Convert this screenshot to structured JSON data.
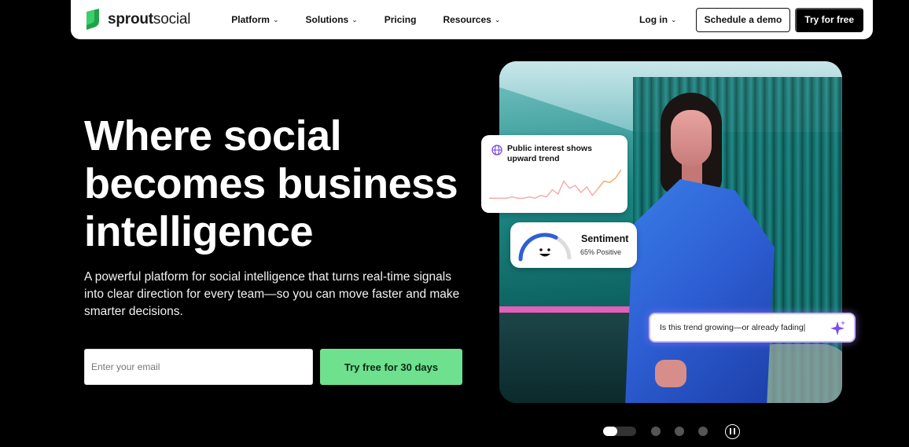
{
  "nav": {
    "logo_bold": "sprout",
    "logo_light": "social",
    "links": [
      {
        "label": "Platform",
        "has_menu": true
      },
      {
        "label": "Solutions",
        "has_menu": true
      },
      {
        "label": "Pricing",
        "has_menu": false
      },
      {
        "label": "Resources",
        "has_menu": true
      }
    ],
    "login_label": "Log in",
    "demo_label": "Schedule a demo",
    "try_label": "Try for free",
    "chevron": "⌄"
  },
  "hero": {
    "headline_lines": [
      "Where social",
      "becomes business",
      "intelligence"
    ],
    "sub_lines": [
      "A powerful platform for social intelligence that turns real-time signals",
      "into clear direction for every team—so you can move faster and make",
      "smarter decisions."
    ],
    "email_placeholder": "Enter your email",
    "cta_label": "Try free for 30 days"
  },
  "cards": {
    "trend_title": "Public interest shows upward trend",
    "trend_series": [
      2,
      2,
      2,
      2,
      3,
      2,
      2,
      3,
      2,
      4,
      3,
      8,
      5,
      14,
      9,
      11,
      6,
      10,
      4,
      9,
      14,
      13,
      16,
      22
    ],
    "sentiment_title": "Sentiment",
    "sentiment_value": "65% Positive",
    "sentiment_fraction": 0.65,
    "prompt_text": "Is this trend growing—or already fading|"
  },
  "carousel": {
    "slide_count": 4,
    "active_index": 0
  },
  "colors": {
    "brand_green": "#1fa34a",
    "cta_green": "#6fe08d",
    "trend_line": "#f4a9a9",
    "trend_up": "#f6a85a",
    "gauge_blue": "#2f5fd6",
    "prompt_glow": "#a978ff"
  }
}
